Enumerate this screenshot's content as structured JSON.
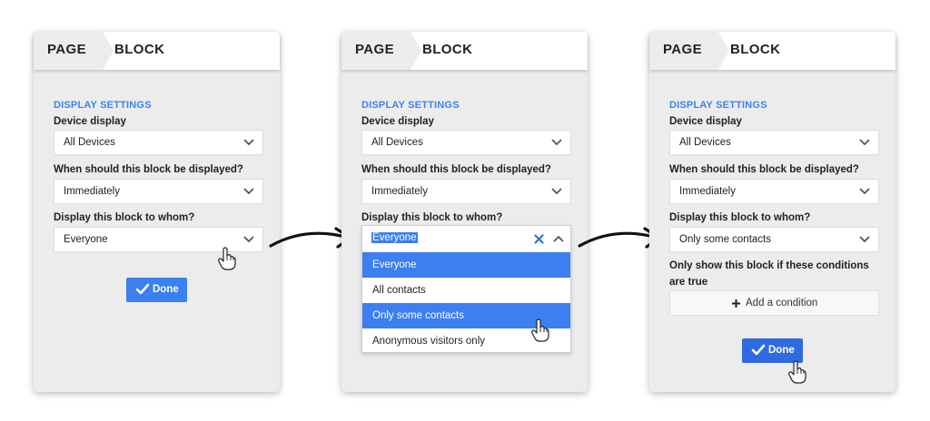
{
  "header": {
    "crumb_page": "PAGE",
    "crumb_block": "BLOCK"
  },
  "section_title": "DISPLAY SETTINGS",
  "fields": {
    "device_label": "Device display",
    "device_value": "All Devices",
    "when_label": "When should this block be displayed?",
    "when_value": "Immediately",
    "whom_label": "Display this block to whom?"
  },
  "panel1": {
    "whom_value": "Everyone",
    "done_label": "Done"
  },
  "panel2": {
    "whom_value": "Everyone",
    "options": [
      "Everyone",
      "All contacts",
      "Only some contacts",
      "Anonymous visitors only"
    ]
  },
  "panel3": {
    "whom_value": "Only some contacts",
    "conditions_label_line1": "Only show this block if these conditions",
    "conditions_label_line2": "are true",
    "add_condition_label": "Add a condition",
    "done_label": "Done"
  },
  "colors": {
    "accent": "#3b7ff0",
    "section": "#3b83f0",
    "clear_x": "#2f6fe0"
  },
  "icons": [
    "chevron-down-icon",
    "chevron-up-icon",
    "close-icon",
    "checkmark-icon",
    "plus-icon",
    "hand-cursor-icon",
    "curved-arrow-icon"
  ]
}
